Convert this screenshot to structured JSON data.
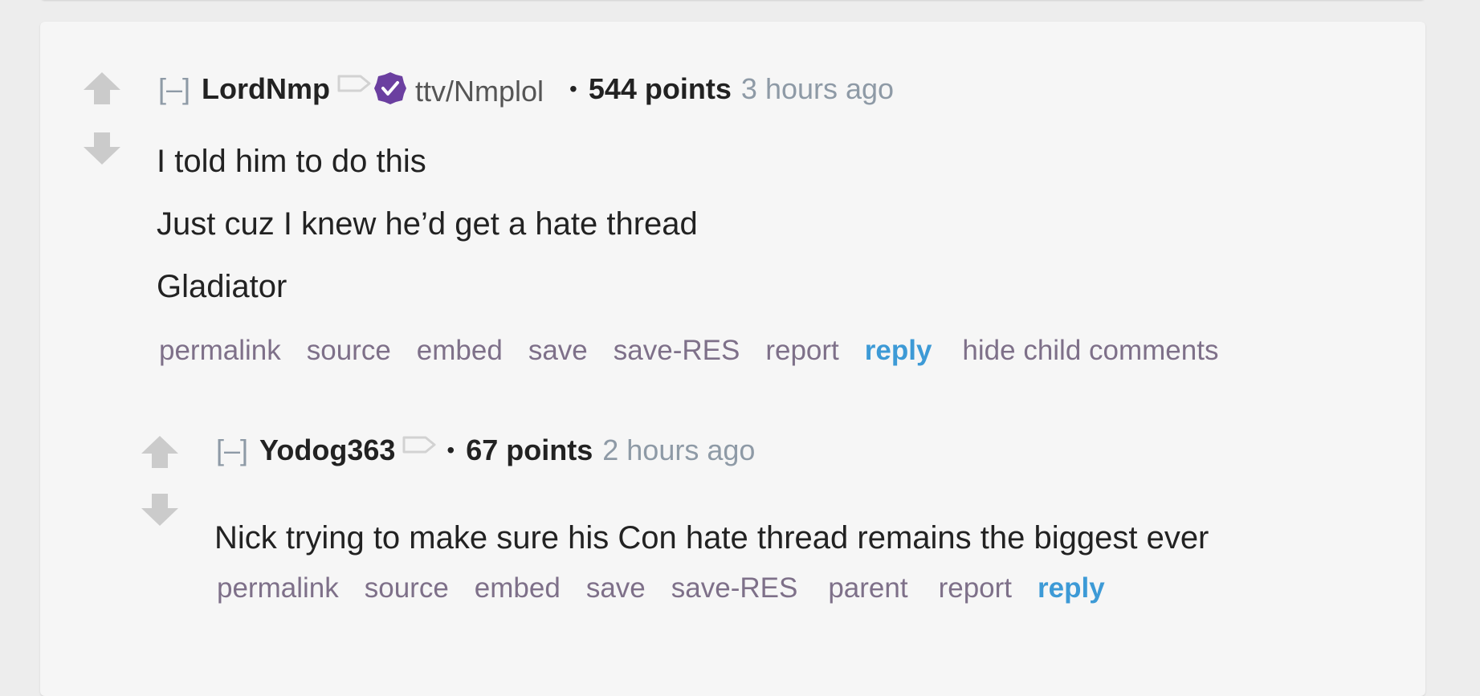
{
  "colors": {
    "page_bg": "#ededed",
    "card_bg": "#f6f6f6",
    "author": "#222222",
    "muted": "#8e9aa6",
    "button_text": "#7e7089",
    "reply": "#3d9ad6",
    "verified_badge": "#6b3fa0",
    "vote_arrow": "#c8c8c8"
  },
  "comments": [
    {
      "collapse": "[–]",
      "author": "LordNmp",
      "flair_icon": "verified-badge-icon",
      "flair_text": "ttv/Nmplol",
      "bullet": "•",
      "points": "544 points",
      "time": "3 hours ago",
      "body": [
        "I told him to do this",
        "Just cuz I knew he’d get a hate thread",
        "Gladiator"
      ],
      "buttons": {
        "permalink": "permalink",
        "source": "source",
        "embed": "embed",
        "save": "save",
        "save_res": "save-RES",
        "report": "report",
        "reply": "reply",
        "hide_children": "hide child comments"
      }
    },
    {
      "collapse": "[–]",
      "author": "Yodog363",
      "bullet": "•",
      "points": "67 points",
      "time": "2 hours ago",
      "body": [
        "Nick trying to make sure his Con hate thread remains the biggest ever"
      ],
      "buttons": {
        "permalink": "permalink",
        "source": "source",
        "embed": "embed",
        "save": "save",
        "save_res": "save-RES",
        "parent": "parent",
        "report": "report",
        "reply": "reply"
      }
    }
  ]
}
